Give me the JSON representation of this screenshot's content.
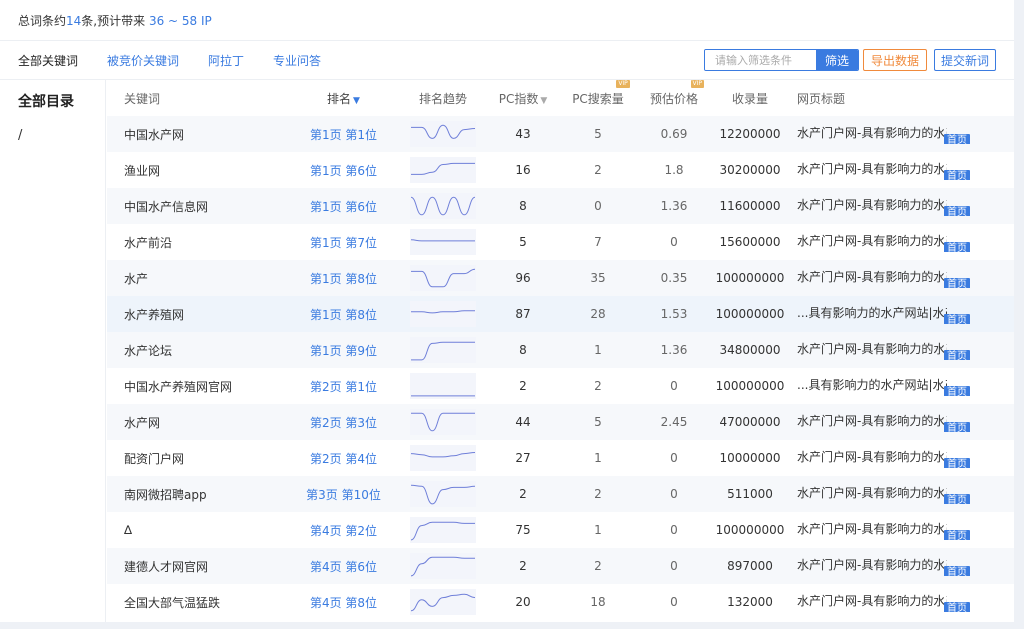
{
  "summary": {
    "prefix": "总词条约",
    "count": "14",
    "middle": "条,预计带来 ",
    "range": "36 ~ 58 IP"
  },
  "tabs": [
    {
      "label": "全部关键词",
      "active": true
    },
    {
      "label": "被竞价关键词",
      "active": false
    },
    {
      "label": "阿拉丁",
      "active": false
    },
    {
      "label": "专业问答",
      "active": false
    }
  ],
  "search": {
    "placeholder": "请输入筛选条件",
    "value": "",
    "button": "筛选"
  },
  "actions": {
    "export": "导出数据",
    "submit": "提交新词"
  },
  "sidebar": {
    "title": "全部目录",
    "item": "/"
  },
  "columns": {
    "keyword": "关键词",
    "rank": "排名",
    "trend": "排名趋势",
    "pc_index": "PC指数",
    "pc_search": "PC搜索量",
    "price": "预估价格",
    "volume": "收录量",
    "title": "网页标题",
    "vip": "VIP"
  },
  "colors": {
    "accent": "#3a7be0",
    "export": "#f08a3c",
    "vip": "#e8b25c",
    "trend_line": "#6f7fd9"
  },
  "rows": [
    {
      "keyword": "中国水产网",
      "rank": "第1页 第1位",
      "pc_index": "43",
      "pc_search": "5",
      "price": "0.69",
      "volume": "12200000",
      "title": "水产门户网-具有影响力的水产",
      "badge": "首页",
      "trend": [
        0.2,
        0.2,
        0.7,
        0.1,
        0.7,
        0.3,
        0.25
      ]
    },
    {
      "keyword": "渔业网",
      "rank": "第1页 第6位",
      "pc_index": "16",
      "pc_search": "2",
      "price": "1.8",
      "volume": "30200000",
      "title": "水产门户网-具有影响力的水产",
      "badge": "首页",
      "trend": [
        0.7,
        0.7,
        0.6,
        0.25,
        0.2,
        0.2,
        0.2
      ]
    },
    {
      "keyword": "中国水产信息网",
      "rank": "第1页 第6位",
      "pc_index": "8",
      "pc_search": "0",
      "price": "1.36",
      "volume": "11600000",
      "title": "水产门户网-具有影响力的水产",
      "badge": "首页",
      "trend": [
        0.1,
        0.9,
        0.1,
        0.9,
        0.1,
        0.9,
        0.1
      ]
    },
    {
      "keyword": "水产前沿",
      "rank": "第1页 第7位",
      "pc_index": "5",
      "pc_search": "7",
      "price": "0",
      "volume": "15600000",
      "title": "水产门户网-具有影响力的水产",
      "badge": "首页",
      "trend": [
        0.4,
        0.45,
        0.45,
        0.45,
        0.45,
        0.45,
        0.45
      ]
    },
    {
      "keyword": "水产",
      "rank": "第1页 第8位",
      "pc_index": "96",
      "pc_search": "35",
      "price": "0.35",
      "volume": "100000000",
      "title": "水产门户网-具有影响力的水产",
      "badge": "首页",
      "trend": [
        0.2,
        0.2,
        0.9,
        0.9,
        0.3,
        0.3,
        0.1
      ]
    },
    {
      "keyword": "水产养殖网",
      "rank": "第1页 第8位",
      "pc_index": "87",
      "pc_search": "28",
      "price": "1.53",
      "volume": "100000000",
      "title": "...具有影响力的水产网站|水产",
      "badge": "首页",
      "trend": [
        0.4,
        0.4,
        0.45,
        0.4,
        0.4,
        0.35,
        0.35
      ]
    },
    {
      "keyword": "水产论坛",
      "rank": "第1页 第9位",
      "pc_index": "8",
      "pc_search": "1",
      "price": "1.36",
      "volume": "34800000",
      "title": "水产门户网-具有影响力的水产",
      "badge": "首页",
      "trend": [
        0.95,
        0.95,
        0.2,
        0.15,
        0.15,
        0.15,
        0.15
      ]
    },
    {
      "keyword": "中国水产养殖网官网",
      "rank": "第2页 第1位",
      "pc_index": "2",
      "pc_search": "2",
      "price": "0",
      "volume": "100000000",
      "title": "...具有影响力的水产网站|水产",
      "badge": "首页",
      "trend": [
        0.95,
        0.95,
        0.95,
        0.95,
        0.95,
        0.95,
        0.95
      ]
    },
    {
      "keyword": "水产网",
      "rank": "第2页 第3位",
      "pc_index": "44",
      "pc_search": "5",
      "price": "2.45",
      "volume": "47000000",
      "title": "水产门户网-具有影响力的水产",
      "badge": "首页",
      "trend": [
        0.1,
        0.1,
        0.9,
        0.1,
        0.1,
        0.1,
        0.1
      ]
    },
    {
      "keyword": "配资门户网",
      "rank": "第2页 第4位",
      "pc_index": "27",
      "pc_search": "1",
      "price": "0",
      "volume": "10000000",
      "title": "水产门户网-具有影响力的水产",
      "badge": "首页",
      "trend": [
        0.3,
        0.35,
        0.45,
        0.45,
        0.4,
        0.3,
        0.25
      ]
    },
    {
      "keyword": "南网微招聘app",
      "rank": "第3页 第10位",
      "pc_index": "2",
      "pc_search": "2",
      "price": "0",
      "volume": "511000",
      "title": "水产门户网-具有影响力的水产",
      "badge": "首页",
      "trend": [
        0.1,
        0.15,
        0.95,
        0.3,
        0.2,
        0.2,
        0.15
      ]
    },
    {
      "keyword": "∆",
      "rank": "第4页 第2位",
      "pc_index": "75",
      "pc_search": "1",
      "price": "0",
      "volume": "100000000",
      "title": "水产门户网-具有影响力的水产",
      "badge": "首页",
      "trend": [
        0.95,
        0.3,
        0.15,
        0.15,
        0.15,
        0.2,
        0.2
      ]
    },
    {
      "keyword": "建德人才网官网",
      "rank": "第4页 第6位",
      "pc_index": "2",
      "pc_search": "2",
      "price": "0",
      "volume": "897000",
      "title": "水产门户网-具有影响力的水产",
      "badge": "首页",
      "trend": [
        0.95,
        0.4,
        0.1,
        0.1,
        0.1,
        0.15,
        0.15
      ]
    },
    {
      "keyword": "全国大部气温猛跌",
      "rank": "第4页 第8位",
      "pc_index": "20",
      "pc_search": "18",
      "price": "0",
      "volume": "132000",
      "title": "水产门户网-具有影响力的水产",
      "badge": "首页",
      "trend": [
        0.9,
        0.4,
        0.7,
        0.3,
        0.2,
        0.15,
        0.3
      ]
    }
  ]
}
